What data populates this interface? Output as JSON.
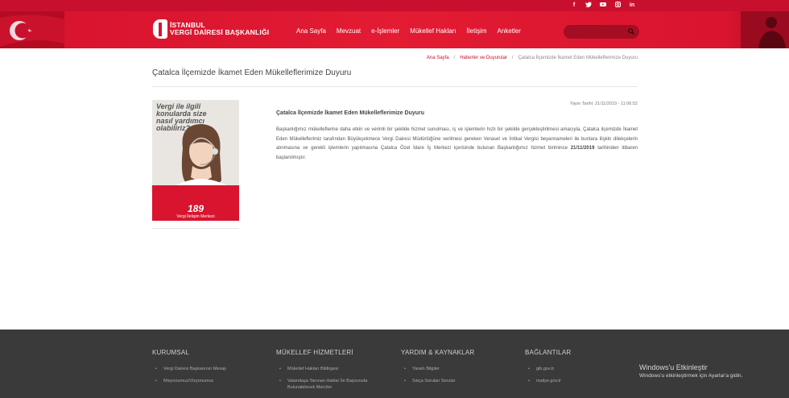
{
  "social": [
    "f",
    "t",
    "yt",
    "ig",
    "in"
  ],
  "header": {
    "logo_line1": "İSTANBUL",
    "logo_line2": "VERGİ DAİRESİ BAŞKANLIĞI",
    "nav": [
      "Ana Sayfa",
      "Mevzuat",
      "e-İşlemler",
      "Mükellef Hakları",
      "İletişim",
      "Anketler"
    ],
    "search_placeholder": ""
  },
  "breadcrumb": {
    "items": [
      "Ana Sayfa",
      "Haberler ve Duyurular",
      "Çatalca İlçemizde İkamet Eden Mükelleflerimize Duyuru"
    ],
    "separator": "/"
  },
  "page_title": "Çatalca İlçemizde İkamet Eden Mükelleflerimize Duyuru",
  "ad": {
    "question": "Vergi ile ilgili konularda size nasıl yardımcı olabiliriz?",
    "number": "189",
    "caption": "Vergi İletişim Merkezi"
  },
  "article": {
    "date": "Yayın Tarihi: 21/11/2019 - 11:06:52",
    "title": "Çatalca İlçemizde İkamet Eden Mükelleflerimize Duyuru",
    "body_before": "Başkanlığımız mükelleflerine daha etkin ve verimli bir şekilde hizmet sunulması, iş ve işlemlerin hızlı bir şekilde gerçekleştirilmesi amacıyla, Çatalca ilçemizde İkamet Eden Mükelleflerimiz tarafından Büyükçekmece Vergi Dairesi Müdürlüğüne verilmesi gereken Veraset ve İntikal Vergisi beyannameleri ile bunlara ilişkin dilekçelerin alınmasına ve gerekli işlemlerin yapılmasına Çatalca Özel İdare İş Merkezi içerisinde bulunan Başkanlığımız hizmet birimince",
    "body_date": "21/11/2019",
    "body_after": "tarihinden itibaren başlanılmıştır."
  },
  "footer": {
    "columns": [
      {
        "title": "KURUMSAL",
        "items": [
          "Vergi Dairesi Başkanının Mesajı",
          "Misyonumuz/Vizyonumuz"
        ]
      },
      {
        "title": "MÜKELLEF HİZMETLERİ",
        "items": [
          "Mükellef Hakları Bildirgesi",
          "Vatandaşa Tanınan Haklar İle Başvuruda Bulunabilecek Merciler"
        ]
      },
      {
        "title": "YARDIM & KAYNAKLAR",
        "items": [
          "Yararlı Bilgiler",
          "Sıkça Sorulan Sorular"
        ]
      },
      {
        "title": "BAĞLANTILAR",
        "items": [
          "gib.gov.tr",
          "maliye.gov.tr"
        ]
      }
    ]
  },
  "windows_overlay": {
    "title": "Windows'u Etkinleştir",
    "subtitle": "Windows'u etkinleştirmek için Ayarlar'a gidin."
  },
  "colors": {
    "brand_red": "#d9142f",
    "footer_bg": "#3a3a3a"
  }
}
